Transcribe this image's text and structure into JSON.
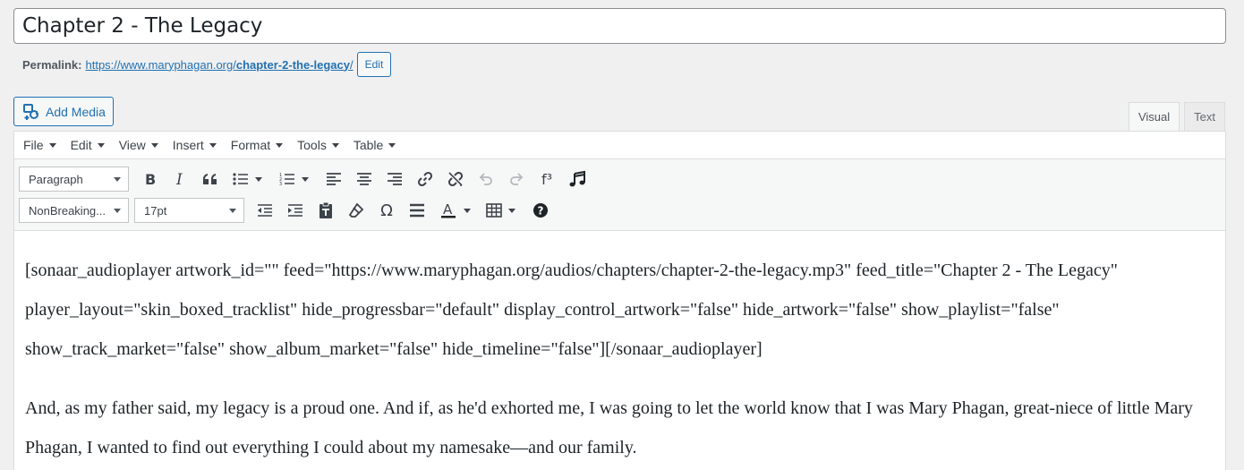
{
  "post": {
    "title": "Chapter 2 - The Legacy"
  },
  "permalink": {
    "label": "Permalink:",
    "base_url": "https://www.maryphagan.org/",
    "slug": "chapter-2-the-legacy",
    "trailing": "/",
    "edit_label": "Edit"
  },
  "media": {
    "add_media_label": "Add Media"
  },
  "editor_tabs": {
    "visual": "Visual",
    "text": "Text",
    "active": "visual"
  },
  "menubar": {
    "items": [
      "File",
      "Edit",
      "View",
      "Insert",
      "Format",
      "Tools",
      "Table"
    ]
  },
  "toolbar": {
    "block_format": "Paragraph",
    "font_family": "NonBreaking...",
    "font_size": "17pt",
    "icons_row1": [
      "bold-icon",
      "italic-icon",
      "blockquote-icon",
      "bullet-list-icon",
      "numbered-list-icon",
      "align-left-icon",
      "align-center-icon",
      "align-right-icon",
      "link-icon",
      "unlink-icon",
      "undo-icon",
      "redo-icon",
      "footnote-icon",
      "audio-icon"
    ],
    "icons_row2": [
      "outdent-icon",
      "indent-icon",
      "paste-as-text-icon",
      "clear-formatting-icon",
      "special-character-icon",
      "horizontal-rule-icon",
      "text-color-icon",
      "table-icon",
      "help-icon"
    ],
    "footnote_glyph": "f³"
  },
  "content": {
    "paragraphs": [
      "[sonaar_audioplayer artwork_id=\"\" feed=\"https://www.maryphagan.org/audios/chapters/chapter-2-the-legacy.mp3\" feed_title=\"Chapter 2 - The Legacy\" player_layout=\"skin_boxed_tracklist\" hide_progressbar=\"default\" display_control_artwork=\"false\" hide_artwork=\"false\" show_playlist=\"false\" show_track_market=\"false\" show_album_market=\"false\" hide_timeline=\"false\"][/sonaar_audioplayer]",
      "And, as my father said, my legacy is a proud one. And if, as he'd exhorted me, I was going to let the world know that I was Mary Phagan, great-niece of little Mary Phagan, I wanted to find out everything I could about my namesake—and our family."
    ]
  },
  "colors": {
    "accent": "#2271b1",
    "background": "#f0f0f1",
    "toolbar": "#f6f7f7"
  }
}
